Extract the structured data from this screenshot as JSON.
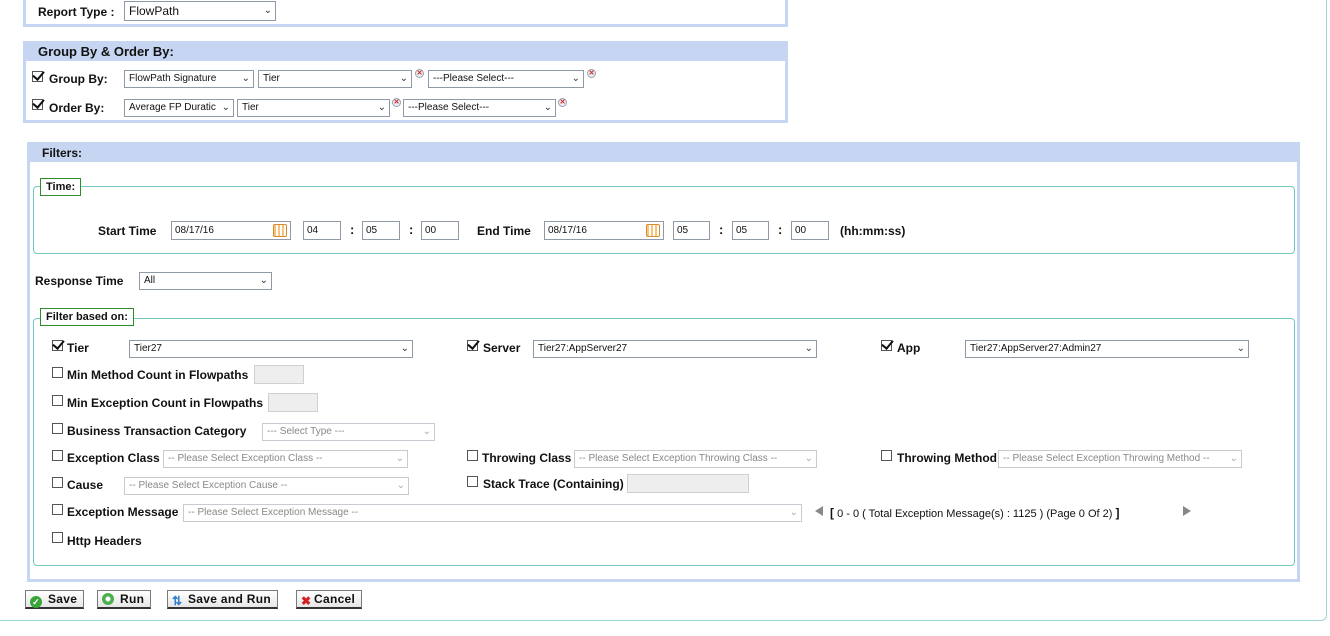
{
  "report_type": {
    "label": "Report Type :",
    "value": "FlowPath"
  },
  "group_order": {
    "title": "Group By & Order By:",
    "group_by": {
      "label": "Group By:",
      "checked": true,
      "select1": "FlowPath Signature",
      "select2": "Tier",
      "select3": "---Please Select---"
    },
    "order_by": {
      "label": "Order By:",
      "checked": true,
      "select1": "Average FP Duratic",
      "select2": "Tier",
      "select3": "---Please Select---"
    }
  },
  "filters": {
    "title": "Filters:",
    "time": {
      "legend": "Time:",
      "start_label": "Start Time",
      "start_date": "08/17/16",
      "start_hh": "04",
      "start_mm": "05",
      "start_ss": "00",
      "end_label": "End Time",
      "end_date": "08/17/16",
      "end_hh": "05",
      "end_mm": "05",
      "end_ss": "00",
      "format": "(hh:mm:ss)",
      "colon": ":"
    },
    "response_time": {
      "label": "Response Time",
      "value": "All"
    },
    "filter_based": {
      "legend": "Filter based on:",
      "tier": {
        "label": "Tier",
        "checked": true,
        "value": "Tier27"
      },
      "server": {
        "label": "Server",
        "checked": true,
        "value": "Tier27:AppServer27"
      },
      "app": {
        "label": "App",
        "checked": true,
        "value": "Tier27:AppServer27:Admin27"
      },
      "min_method": {
        "label": "Min Method Count in Flowpaths",
        "checked": false,
        "value": ""
      },
      "min_exception": {
        "label": "Min Exception Count in Flowpaths",
        "checked": false,
        "value": ""
      },
      "bt_category": {
        "label": "Business Transaction Category",
        "checked": false,
        "value": "--- Select Type ---"
      },
      "exception_class": {
        "label": "Exception Class",
        "checked": false,
        "value": "-- Please Select Exception Class --"
      },
      "throwing_class": {
        "label": "Throwing Class",
        "checked": false,
        "value": "-- Please Select Exception Throwing Class --"
      },
      "throwing_method": {
        "label": "Throwing Method",
        "checked": false,
        "value": "-- Please Select Exception Throwing Method --"
      },
      "cause": {
        "label": "Cause",
        "checked": false,
        "value": "-- Please Select Exception Cause --"
      },
      "stack_trace": {
        "label": "Stack Trace (Containing)",
        "checked": false,
        "value": ""
      },
      "exception_message": {
        "label": "Exception Message",
        "checked": false,
        "value": "-- Please Select Exception Message --"
      },
      "pager": {
        "open": "[",
        "text": "0 - 0 ( Total Exception Message(s) : 1125 ) (Page 0 Of 2)",
        "close": "]"
      },
      "http_headers": {
        "label": "Http Headers",
        "checked": false
      }
    }
  },
  "buttons": {
    "save": "Save",
    "run": "Run",
    "save_run": "Save and Run",
    "cancel": "Cancel"
  },
  "icons": {
    "save": "check-circle-icon",
    "run": "play-circle-icon",
    "save_run": "refresh-icon",
    "cancel": "x-icon"
  },
  "colors": {
    "panel_header": "#c6d6f2",
    "fieldset_border": "#6fc9c0",
    "legend_border": "#2e8b2e"
  }
}
